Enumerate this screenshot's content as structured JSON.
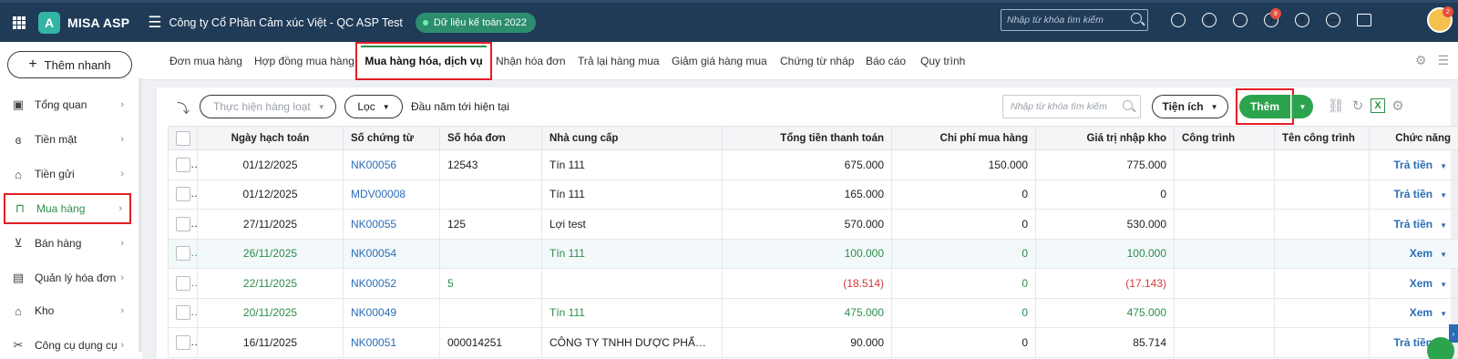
{
  "header": {
    "app_name": "MISA ASP",
    "logo_letter": "A",
    "company": "Công ty Cổ Phần Cảm xúc Việt - QC ASP Test",
    "data_badge": "Dữ liệu kế toán 2022",
    "search_placeholder": "Nhập từ khóa tìm kiếm",
    "notification_count": "8",
    "avatar_badge": "2"
  },
  "sidebar": {
    "quick_add": "Thêm nhanh",
    "items": [
      {
        "label": "Tổng quan",
        "icon": "dashboard-icon"
      },
      {
        "label": "Tiền mặt",
        "icon": "money-bag-icon"
      },
      {
        "label": "Tiền gửi",
        "icon": "bank-icon"
      },
      {
        "label": "Mua hàng",
        "icon": "shopping-bag-icon"
      },
      {
        "label": "Bán hàng",
        "icon": "cart-icon"
      },
      {
        "label": "Quản lý hóa đơn",
        "icon": "invoice-icon"
      },
      {
        "label": "Kho",
        "icon": "warehouse-icon"
      },
      {
        "label": "Công cụ dụng cụ",
        "icon": "tools-icon"
      }
    ]
  },
  "tabs": [
    "Đơn mua hàng",
    "Hợp đồng mua hàng",
    "Mua hàng hóa, dịch vụ",
    "Nhận hóa đơn",
    "Trả lại hàng mua",
    "Giảm giá hàng mua",
    "Chứng từ nháp",
    "Báo cáo",
    "Quy trình"
  ],
  "toolbar": {
    "batch_label": "Thực hiện hàng loạt",
    "filter_label": "Lọc",
    "period": "Đầu năm tới hiện tại",
    "search_placeholder": "Nhập từ khóa tìm kiếm",
    "utility_label": "Tiện ích",
    "add_label": "Thêm"
  },
  "table": {
    "columns": [
      "Ngày hạch toán",
      "Số chứng từ",
      "Số hóa đơn",
      "Nhà cung cấp",
      "Tổng tiền thanh toán",
      "Chi phí mua hàng",
      "Giá trị nhập kho",
      "Công trình",
      "Tên công trình",
      "Chức năng"
    ],
    "rows": [
      {
        "date": "01/12/2025",
        "doc": "NK00056",
        "invoice": "12543",
        "supplier": "Tín 111",
        "total": "675.000",
        "cost": "150.000",
        "value": "775.000",
        "project": "",
        "project_name": "",
        "action": "Trả tiền"
      },
      {
        "date": "01/12/2025",
        "doc": "MDV00008",
        "invoice": "",
        "supplier": "Tín 111",
        "total": "165.000",
        "cost": "0",
        "value": "0",
        "project": "",
        "project_name": "",
        "action": "Trả tiền"
      },
      {
        "date": "27/11/2025",
        "doc": "NK00055",
        "invoice": "125",
        "supplier": "Lợi test",
        "total": "570.000",
        "cost": "0",
        "value": "530.000",
        "project": "",
        "project_name": "",
        "action": "Trả tiền"
      },
      {
        "date": "26/11/2025",
        "doc": "NK00054",
        "invoice": "",
        "supplier": "Tín 111",
        "total": "100.000",
        "cost": "0",
        "value": "100.000",
        "project": "",
        "project_name": "",
        "action": "Xem"
      },
      {
        "date": "22/11/2025",
        "doc": "NK00052",
        "invoice": "5",
        "supplier": "",
        "total": "(18.514)",
        "cost": "0",
        "value": "(17.143)",
        "project": "",
        "project_name": "",
        "action": "Xem"
      },
      {
        "date": "20/11/2025",
        "doc": "NK00049",
        "invoice": "",
        "supplier": "Tín 111",
        "total": "475.000",
        "cost": "0",
        "value": "475.000",
        "project": "",
        "project_name": "",
        "action": "Xem"
      },
      {
        "date": "16/11/2025",
        "doc": "NK00051",
        "invoice": "000014251",
        "supplier": "CÔNG TY TNHH DƯỢC PHẨM ...",
        "total": "90.000",
        "cost": "0",
        "value": "85.714",
        "project": "",
        "project_name": "",
        "action": "Trả tiền"
      }
    ]
  },
  "colors": {
    "header_bg": "#1f3b57",
    "accent_green": "#2ca44e",
    "link_blue": "#2a6db8",
    "highlight_red": "#e31e24"
  }
}
